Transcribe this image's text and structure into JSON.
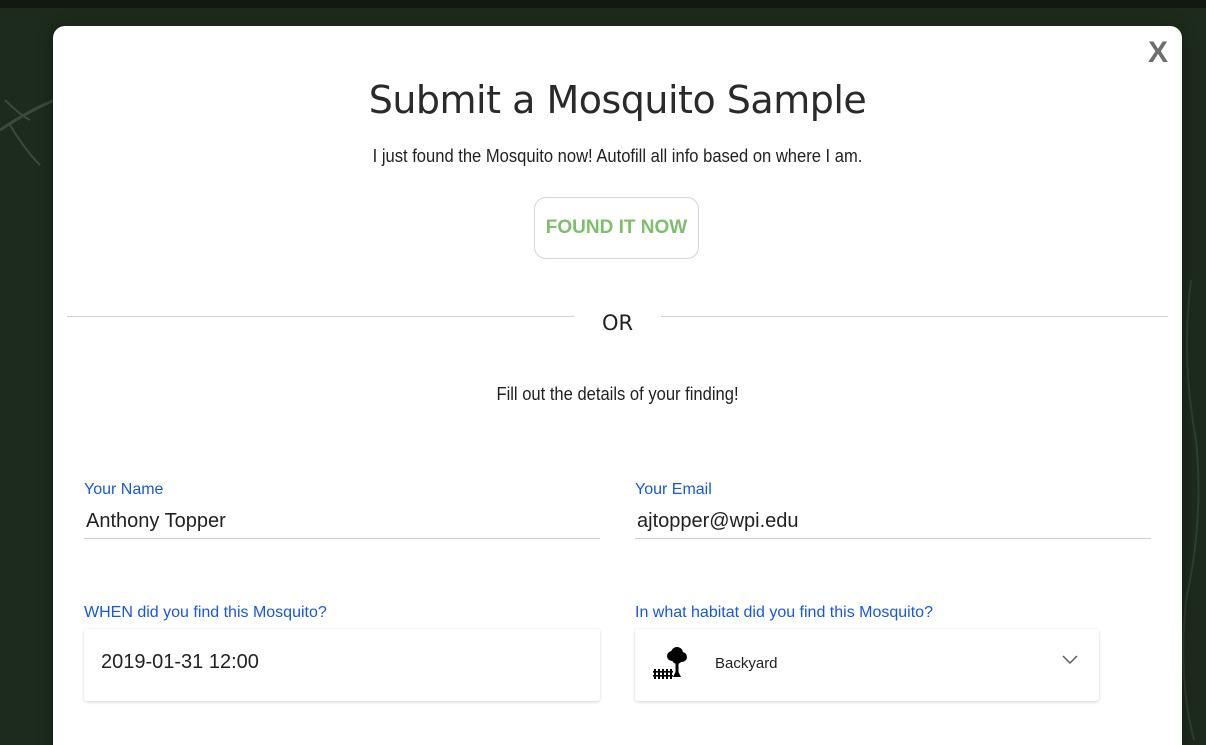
{
  "modal": {
    "close_label": "X",
    "title": "Submit a Mosquito Sample",
    "autofill_prompt": "I just found the Mosquito now! Autofill all info based on where I am.",
    "found_button_label": "FOUND IT NOW",
    "or_label": "OR",
    "fill_prompt": "Fill out the details of your finding!"
  },
  "form": {
    "name": {
      "label": "Your Name",
      "value": "Anthony Topper"
    },
    "email": {
      "label": "Your Email",
      "value": "ajtopper@wpi.edu"
    },
    "when": {
      "label": "WHEN did you find this Mosquito?",
      "value": "2019-01-31 12:00"
    },
    "habitat": {
      "label": "In what habitat did you find this Mosquito?",
      "selected": "Backyard",
      "icon": "backyard-icon"
    }
  },
  "colors": {
    "accent_label": "#1a57d6",
    "found_button_text": "#7fbf6c",
    "background": "#1d2b1c"
  }
}
